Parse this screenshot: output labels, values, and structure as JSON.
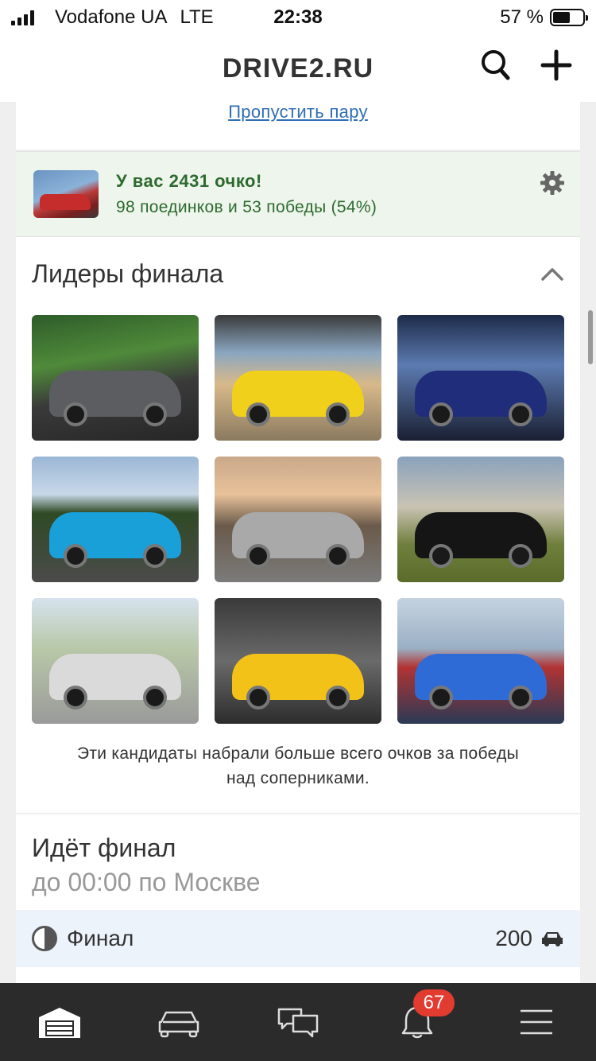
{
  "status_bar": {
    "carrier": "Vodafone UA",
    "network": "LTE",
    "time": "22:38",
    "battery_percent": "57 %",
    "battery_level": 0.57
  },
  "nav": {
    "title": "DRIVE2.RU",
    "search_icon": "search-icon",
    "add_icon": "plus-icon"
  },
  "skip": {
    "label": "Пропустить пару"
  },
  "score": {
    "headline": "У вас 2431 очко!",
    "stats": "98 поединков и 53 победы (54%)",
    "settings_icon": "gear-icon"
  },
  "leaders": {
    "title": "Лидеры финала",
    "collapse_icon": "chevron-up-icon",
    "note_line1": "Эти кандидаты набрали больше всего очков за победы",
    "note_line2": "над соперниками.",
    "photos": [
      {
        "bg": "linear-gradient(170deg,#2e5c2a 0%,#4f8a3a 35%,#3a3a3a 60%,#262626 100%)",
        "car": "#5b5d61"
      },
      {
        "bg": "linear-gradient(180deg,#3a3a3a 0%,#8aa6c0 30%,#d8b98a 55%,#8b7a60 100%)",
        "car": "#f1d01c"
      },
      {
        "bg": "linear-gradient(180deg,#1d2b4a 0%,#5c7bb0 40%,#1a1f33 100%)",
        "car": "#1f2d7a"
      },
      {
        "bg": "linear-gradient(180deg,#9bb7d6 0%,#c8d8e8 30%,#2f4a25 45%,#4b4b4b 100%)",
        "car": "#1aa0d9"
      },
      {
        "bg": "linear-gradient(180deg,#c9a88a 0%,#e8c29a 30%,#6a5a4a 55%,#7b7b7b 100%)",
        "car": "#a9a9aa"
      },
      {
        "bg": "linear-gradient(180deg,#8aa2bd 0%,#c9c3b3 40%,#6f7f3c 70%,#5b6b2b 100%)",
        "car": "#151515"
      },
      {
        "bg": "linear-gradient(180deg,#d6e2ee 0%,#b8c8a8 40%,#9a9a9a 100%)",
        "car": "#dadada"
      },
      {
        "bg": "linear-gradient(180deg,#3a3a3a 0%,#6a6a6a 50%,#2c2c2c 100%)",
        "car": "#f2c218"
      },
      {
        "bg": "linear-gradient(180deg,#c5d3e0 0%,#9ab0c4 40%,#b23333 55%,#2a3a55 100%)",
        "car": "#2f6bd6"
      }
    ]
  },
  "final": {
    "title": "Идёт финал",
    "subtitle": "до 00:00 по Москве",
    "row_label": "Финал",
    "row_count": "200",
    "row_icon": "half-circle-icon",
    "count_icon": "car-icon"
  },
  "tabbar": {
    "items": [
      {
        "name": "garage-icon"
      },
      {
        "name": "car-icon"
      },
      {
        "name": "chat-icon"
      },
      {
        "name": "bell-icon",
        "badge": "67"
      },
      {
        "name": "menu-icon"
      }
    ]
  }
}
